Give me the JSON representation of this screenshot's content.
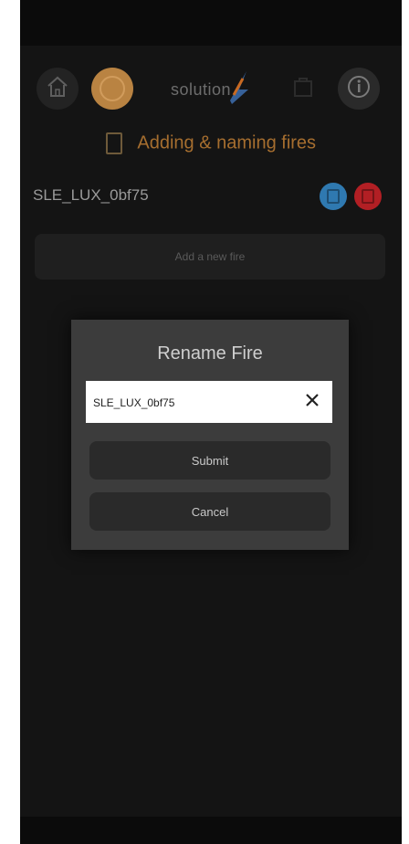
{
  "header": {
    "logo_text": "solution",
    "title": "Adding & naming fires"
  },
  "icons": {
    "home": "home-icon",
    "flame": "flame-icon",
    "bag": "bag-icon",
    "info": "info-icon",
    "edit": "edit-icon",
    "delete": "delete-icon",
    "clear": "close-icon"
  },
  "fires": [
    {
      "name": "SLE_LUX_0bf75"
    }
  ],
  "add_fire_label": "Add a new fire",
  "modal": {
    "title": "Rename Fire",
    "input_value": "SLE_LUX_0bf75",
    "submit_label": "Submit",
    "cancel_label": "Cancel"
  },
  "colors": {
    "accent": "#a66e2f",
    "edit": "#2f79b0",
    "delete": "#b21f24",
    "background": "#141414"
  }
}
